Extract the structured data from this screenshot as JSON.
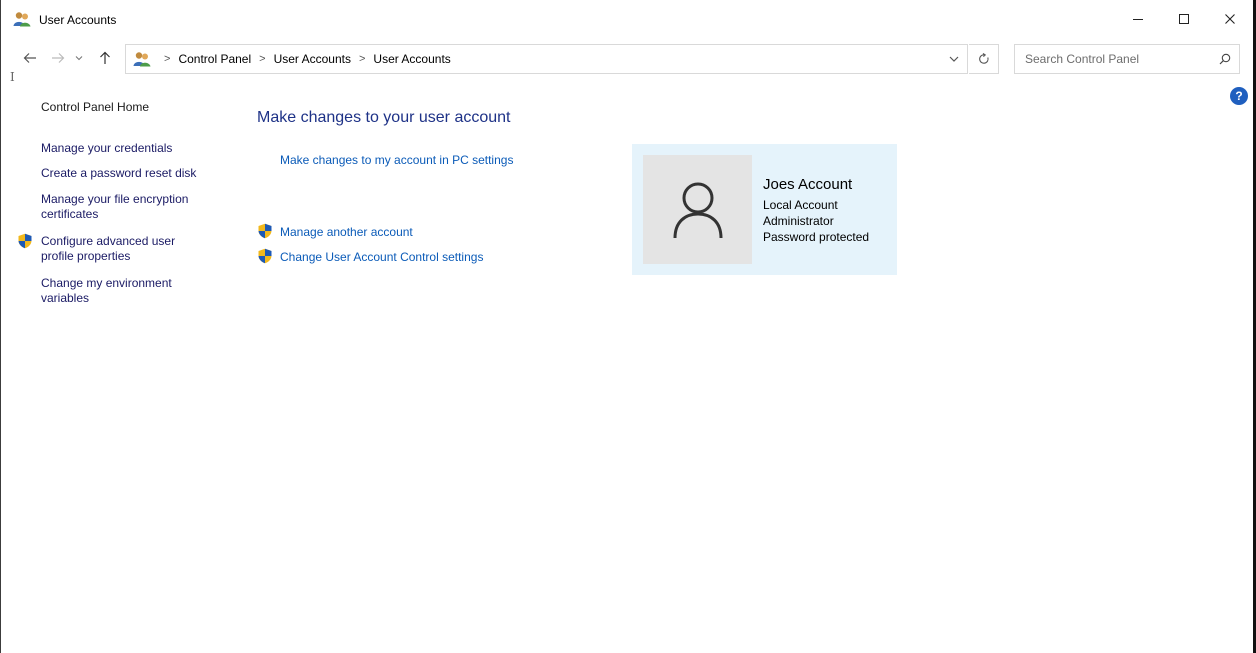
{
  "window": {
    "title": "User Accounts"
  },
  "nav": {
    "breadcrumbs": [
      "Control Panel",
      "User Accounts",
      "User Accounts"
    ],
    "search_placeholder": "Search Control Panel",
    "icons": {
      "back": "arrow-left-icon",
      "forward": "arrow-right-icon",
      "recent": "chevron-down-icon",
      "up": "arrow-up-icon",
      "refresh": "refresh-icon",
      "search": "search-icon"
    }
  },
  "sidebar": {
    "home": "Control Panel Home",
    "items": [
      {
        "label": "Manage your credentials",
        "shield": false
      },
      {
        "label": "Create a password reset disk",
        "shield": false
      },
      {
        "label": "Manage your file encryption certificates",
        "shield": false
      },
      {
        "label": "Configure advanced user profile properties",
        "shield": true
      },
      {
        "label": "Change my environment variables",
        "shield": false
      }
    ]
  },
  "main": {
    "title": "Make changes to your user account",
    "pc_settings_link": "Make changes to my account in PC settings",
    "manage_another": "Manage another account",
    "uac_settings": "Change User Account Control settings"
  },
  "account": {
    "name": "Joes Account",
    "type": "Local Account",
    "role": "Administrator",
    "protection": "Password protected"
  },
  "help": "?",
  "colors": {
    "link": "#0b5bb8",
    "title": "#1e3287",
    "card_bg": "#e5f3fb",
    "help_bg": "#1f5fbf"
  }
}
